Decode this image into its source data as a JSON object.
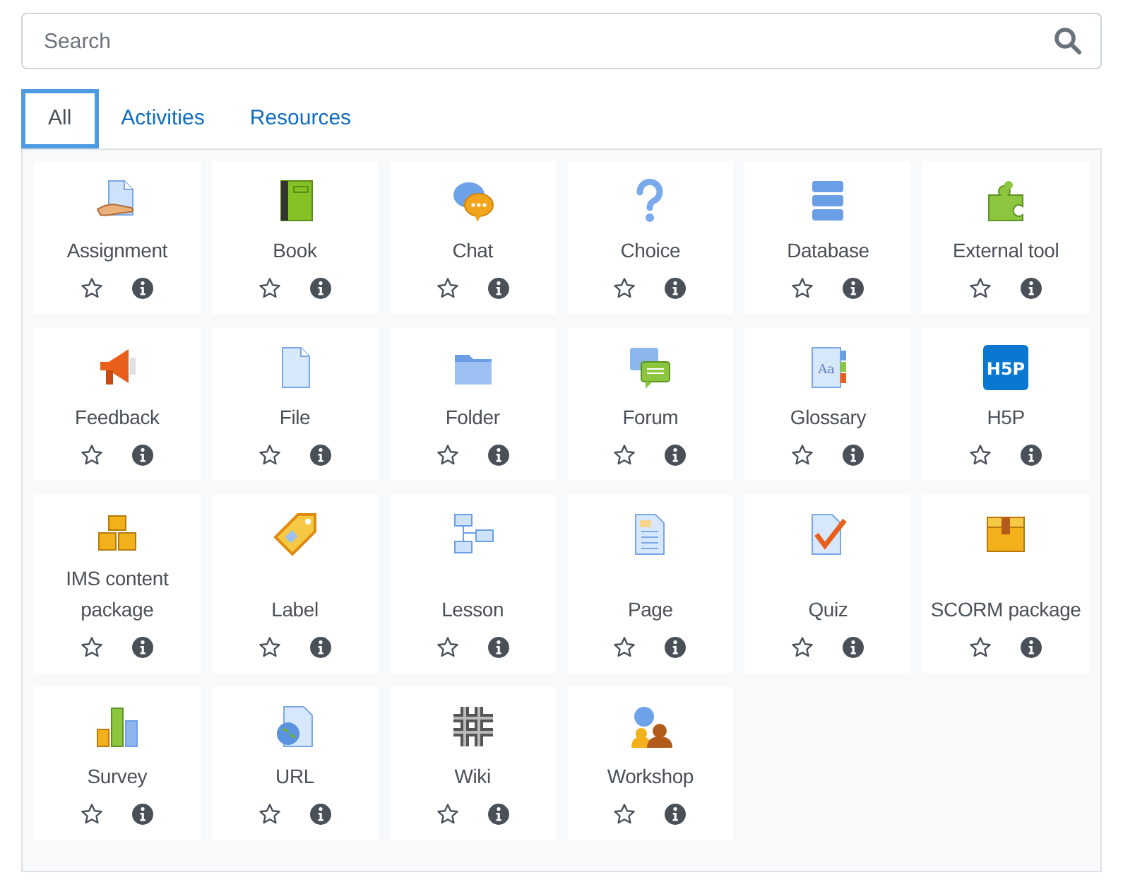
{
  "search": {
    "placeholder": "Search"
  },
  "tabs": [
    {
      "label": "All",
      "selected": true
    },
    {
      "label": "Activities",
      "selected": false
    },
    {
      "label": "Resources",
      "selected": false
    }
  ],
  "modules": [
    {
      "kind": "assignment",
      "label": "Assignment",
      "starred": false
    },
    {
      "kind": "book",
      "label": "Book",
      "starred": false
    },
    {
      "kind": "chat",
      "label": "Chat",
      "starred": false
    },
    {
      "kind": "choice",
      "label": "Choice",
      "starred": false
    },
    {
      "kind": "database",
      "label": "Database",
      "starred": false
    },
    {
      "kind": "external",
      "label": "External tool",
      "starred": false
    },
    {
      "kind": "feedback",
      "label": "Feedback",
      "starred": false
    },
    {
      "kind": "file",
      "label": "File",
      "starred": false
    },
    {
      "kind": "folder",
      "label": "Folder",
      "starred": false
    },
    {
      "kind": "forum",
      "label": "Forum",
      "starred": false
    },
    {
      "kind": "glossary",
      "label": "Glossary",
      "starred": false,
      "icon_text": "Aa"
    },
    {
      "kind": "h5p",
      "label": "H5P",
      "starred": false,
      "icon_text": "H5P"
    },
    {
      "kind": "ims",
      "label": "IMS content package",
      "starred": false
    },
    {
      "kind": "label",
      "label": "Label",
      "starred": false
    },
    {
      "kind": "lesson",
      "label": "Lesson",
      "starred": false
    },
    {
      "kind": "page",
      "label": "Page",
      "starred": false
    },
    {
      "kind": "quiz",
      "label": "Quiz",
      "starred": false
    },
    {
      "kind": "scorm",
      "label": "SCORM package",
      "starred": false
    },
    {
      "kind": "survey",
      "label": "Survey",
      "starred": false
    },
    {
      "kind": "url",
      "label": "URL",
      "starred": false
    },
    {
      "kind": "wiki",
      "label": "Wiki",
      "starred": false
    },
    {
      "kind": "workshop",
      "label": "Workshop",
      "starred": false
    }
  ]
}
